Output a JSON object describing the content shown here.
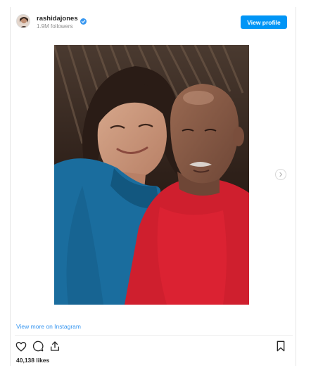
{
  "post": {
    "username": "rashidajones",
    "followers": "1.9M followers",
    "view_profile_label": "View profile",
    "view_more_label": "View more on Instagram",
    "likes": "40,138 likes"
  },
  "icons": {
    "verified": "verified-badge-icon",
    "next": "chevron-right-icon",
    "like": "heart-icon",
    "comment": "comment-icon",
    "share": "share-icon",
    "save": "bookmark-icon"
  },
  "colors": {
    "accent": "#0095f6",
    "link": "#3897f0",
    "text": "#262626",
    "muted": "#8e8e8e"
  }
}
